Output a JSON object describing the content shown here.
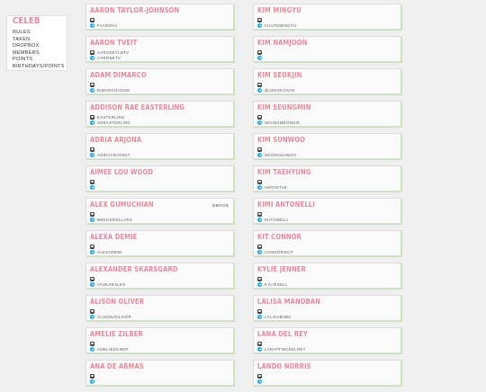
{
  "site": {
    "title": "CELEB"
  },
  "nav": [
    "RULES",
    "TAKEN",
    "DROPBOX",
    "MEMBERS",
    "POINTS",
    "BIRTHDAYS/POINTS"
  ],
  "left_cards": [
    {
      "name": "AARON TAYLOR-JOHNSON",
      "instagram": "",
      "twitter": "FAAROHJ",
      "tag": ""
    },
    {
      "name": "AARON TVEIT",
      "instagram": "AARONEYLBTV",
      "twitter": "AARONKTV",
      "tag": ""
    },
    {
      "name": "ADAM DIMARCO",
      "instagram": "",
      "twitter": "DIMARCOADAM",
      "tag": ""
    },
    {
      "name": "ADDISON RAE EASTERLING",
      "instagram": "EASTERLING",
      "twitter": "ADEASTERLING",
      "tag": ""
    },
    {
      "name": "ADRIA ARJONA",
      "instagram": "",
      "twitter": "ADRIAARJONAT",
      "tag": ""
    },
    {
      "name": "AIMEE LOU WOOD",
      "instagram": "",
      "twitter": "",
      "tag": ""
    },
    {
      "name": "ALEX GUMUCHIAN",
      "instagram": "",
      "twitter": "BBNOSDOLLARS",
      "tag": "BBNO$"
    },
    {
      "name": "ALEXA DEMIE",
      "instagram": "",
      "twitter": "ALEXADEMI",
      "tag": ""
    },
    {
      "name": "ALEXANDER SKARSGARD",
      "instagram": "",
      "twitter": "VASKARALEX",
      "tag": ""
    },
    {
      "name": "ALISON OLIVER",
      "instagram": "",
      "twitter": "ALISONJOLIVER",
      "tag": ""
    },
    {
      "name": "AMELIE ZILBER",
      "instagram": "",
      "twitter": "AMELIEZILBER",
      "tag": ""
    },
    {
      "name": "ANA DE ARMAS",
      "instagram": "",
      "twitter": "",
      "tag": ""
    }
  ],
  "right_cards": [
    {
      "name": "KIM MINGYU",
      "instagram": "",
      "twitter": "CHUTEMINGYU",
      "tag": ""
    },
    {
      "name": "KIM NAMJOON",
      "instagram": "",
      "twitter": "",
      "tag": ""
    },
    {
      "name": "KIM SEOKJIN",
      "instagram": "",
      "twitter": "@JSEOKJINYK",
      "tag": ""
    },
    {
      "name": "KIM SEUNGMIN",
      "instagram": "",
      "twitter": "SEUNGMEONGIE",
      "tag": ""
    },
    {
      "name": "KIM SUNWOO",
      "instagram": "",
      "twitter": "SEONGSUWOO",
      "tag": ""
    },
    {
      "name": "KIM TAEHYUNG",
      "instagram": "",
      "twitter": "AMTAKTAE",
      "tag": ""
    },
    {
      "name": "KIMI ANTONELLI",
      "instagram": "",
      "twitter": "KKTONELLI",
      "tag": ""
    },
    {
      "name": "KIT CONNOR",
      "instagram": "",
      "twitter": "CONNORSKIT",
      "tag": ""
    },
    {
      "name": "KYLIE JENNER",
      "instagram": "",
      "twitter": "KYLIESELL",
      "tag": ""
    },
    {
      "name": "LALISA MANOBAN",
      "instagram": "",
      "twitter": "LALISABUBU",
      "tag": ""
    },
    {
      "name": "LANA DEL REY",
      "instagram": "",
      "twitter": "LANAFFINCEELREY",
      "tag": ""
    },
    {
      "name": "LANDO NORRIS",
      "instagram": "",
      "twitter": "",
      "tag": ""
    }
  ],
  "colors": {
    "name_pink": "#e28a9d",
    "twitter_blue": "#2aa9e0",
    "card_shadow": "#c9e0b8"
  },
  "icons": {
    "instagram": "instagram-icon",
    "twitter": "twitter-icon"
  }
}
